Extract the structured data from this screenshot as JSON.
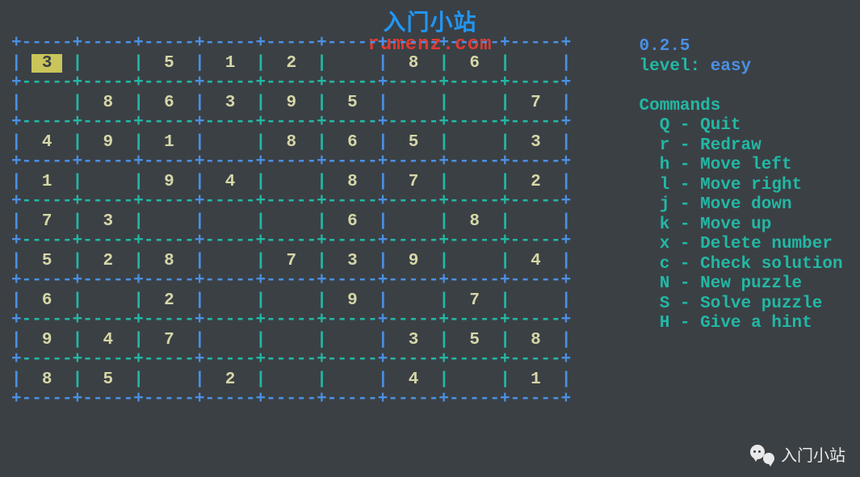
{
  "branding": {
    "site_name_cn": "入门小站",
    "domain": "rumenz.com"
  },
  "app": {
    "version": "0.2.5",
    "level_label": "level:",
    "level_value": "easy"
  },
  "commands_header": "Commands",
  "commands": [
    {
      "key": "Q",
      "desc": "Quit"
    },
    {
      "key": "r",
      "desc": "Redraw"
    },
    {
      "key": "h",
      "desc": "Move left"
    },
    {
      "key": "l",
      "desc": "Move right"
    },
    {
      "key": "j",
      "desc": "Move down"
    },
    {
      "key": "k",
      "desc": "Move up"
    },
    {
      "key": "x",
      "desc": "Delete number"
    },
    {
      "key": "c",
      "desc": "Check solution"
    },
    {
      "key": "N",
      "desc": "New puzzle"
    },
    {
      "key": "S",
      "desc": "Solve puzzle"
    },
    {
      "key": "H",
      "desc": "Give a hint"
    }
  ],
  "sudoku": {
    "cursor": [
      0,
      0
    ],
    "cells": [
      [
        "3",
        "",
        "5",
        "1",
        "2",
        "",
        "8",
        "6",
        ""
      ],
      [
        "",
        "8",
        "6",
        "3",
        "9",
        "5",
        "",
        "",
        "7"
      ],
      [
        "4",
        "9",
        "1",
        "",
        "8",
        "6",
        "5",
        "",
        "3"
      ],
      [
        "1",
        "",
        "9",
        "4",
        "",
        "8",
        "7",
        "",
        "2"
      ],
      [
        "7",
        "3",
        "",
        "",
        "",
        "6",
        "",
        "8",
        ""
      ],
      [
        "5",
        "2",
        "8",
        "",
        "7",
        "3",
        "9",
        "",
        "4"
      ],
      [
        "6",
        "",
        "2",
        "",
        "",
        "9",
        "",
        "7",
        ""
      ],
      [
        "9",
        "4",
        "7",
        "",
        "",
        "",
        "3",
        "5",
        "8"
      ],
      [
        "8",
        "5",
        "",
        "2",
        "",
        "",
        "4",
        "",
        "1"
      ]
    ]
  },
  "watermark": {
    "text": "入门小站"
  }
}
